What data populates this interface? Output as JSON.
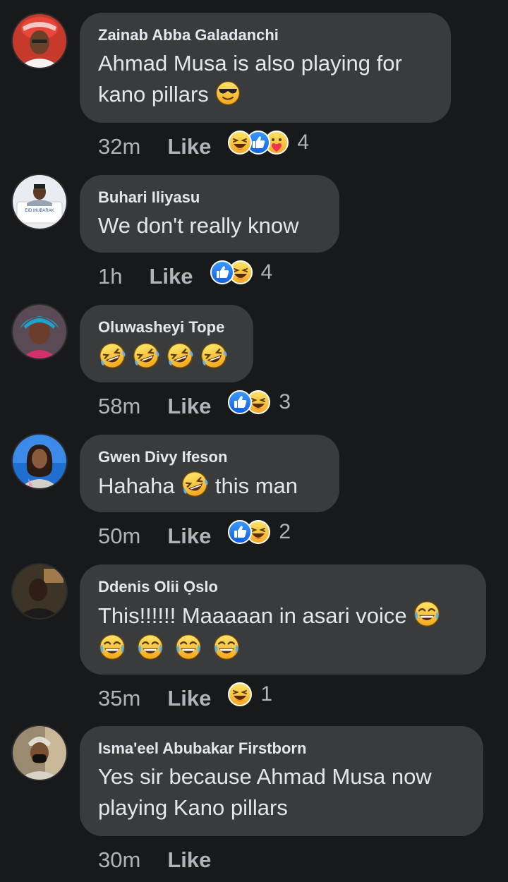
{
  "comments": [
    {
      "author": "Zainab Abba Galadanchi",
      "line1": "Ahmad Musa is also playing for",
      "line2": "kano pillars",
      "time": "32m",
      "like": "Like",
      "reaction_count": "4",
      "reactions": [
        "haha-icon",
        "like-icon",
        "care-icon"
      ]
    },
    {
      "author": "Buhari Iliyasu",
      "line1": "We don't really know",
      "time": "1h",
      "like": "Like",
      "reaction_count": "4",
      "reactions": [
        "like-icon",
        "haha-icon"
      ],
      "avatar_text": "EID MUBARAK"
    },
    {
      "author": "Oluwasheyi Tope",
      "line1": "",
      "time": "58m",
      "like": "Like",
      "reaction_count": "3",
      "reactions": [
        "like-icon",
        "haha-icon"
      ]
    },
    {
      "author": "Gwen Divy Ifeson",
      "line1_a": "Hahaha",
      "line1_b": "this man",
      "time": "50m",
      "like": "Like",
      "reaction_count": "2",
      "reactions": [
        "like-icon",
        "haha-icon"
      ]
    },
    {
      "author": "Ddenis Olii Ọslo",
      "line1": "This!!!!!! Maaaaan in asari voice",
      "time": "35m",
      "like": "Like",
      "reaction_count": "1",
      "reactions": [
        "haha-icon"
      ]
    },
    {
      "author": "Isma'eel Abubakar Firstborn",
      "line1": "Yes sir because Ahmad Musa now",
      "line2": "playing Kano pillars",
      "time": "30m",
      "like": "Like"
    }
  ],
  "colors": {
    "background": "#18191a",
    "bubble": "#3a3b3c",
    "text": "#e4e6eb",
    "meta": "#b0b3b8",
    "like_blue": "#1877f2",
    "haha_yellow": "#f7c843"
  }
}
